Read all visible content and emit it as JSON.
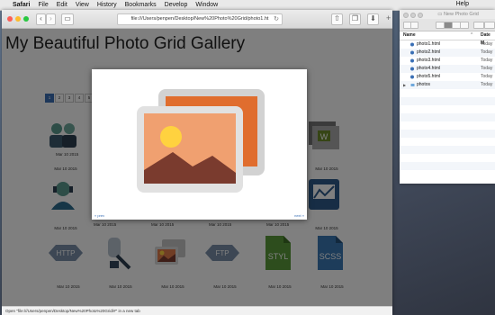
{
  "menubar": {
    "app": "Safari",
    "items": [
      "File",
      "Edit",
      "View",
      "History",
      "Bookmarks",
      "Develop",
      "Window",
      "Help"
    ]
  },
  "browser": {
    "address": "file:///Users/penpen/Desktop/New%20Photo%20Grid/photo1.ht",
    "page_title": "My Beautiful Photo Grid Gallery",
    "pager": [
      "1",
      "2",
      "3",
      "4",
      "5"
    ],
    "pager_active": 1,
    "thumb_date": "Mar 10 2015",
    "status": "Open \"file:///Users/penpen/Desktop/New%20Photo%20Grid/#\" in a new tab",
    "lightbox": {
      "prev": "« prev",
      "next": "next »"
    }
  },
  "finder": {
    "title": "New Photo Grid",
    "col_name": "Name",
    "col_date": "Date M",
    "files": [
      {
        "name": "photo1.html",
        "date": "Today"
      },
      {
        "name": "photo2.html",
        "date": "Today"
      },
      {
        "name": "photo3.html",
        "date": "Today"
      },
      {
        "name": "photo4.html",
        "date": "Today"
      },
      {
        "name": "photo5.html",
        "date": "Today"
      },
      {
        "name": "photos",
        "date": "Today"
      }
    ]
  },
  "colors": {
    "accent": "#3a6fb5",
    "orange": "#f0a070",
    "sun": "#ffd23f",
    "mountain": "#7a3b2e"
  }
}
